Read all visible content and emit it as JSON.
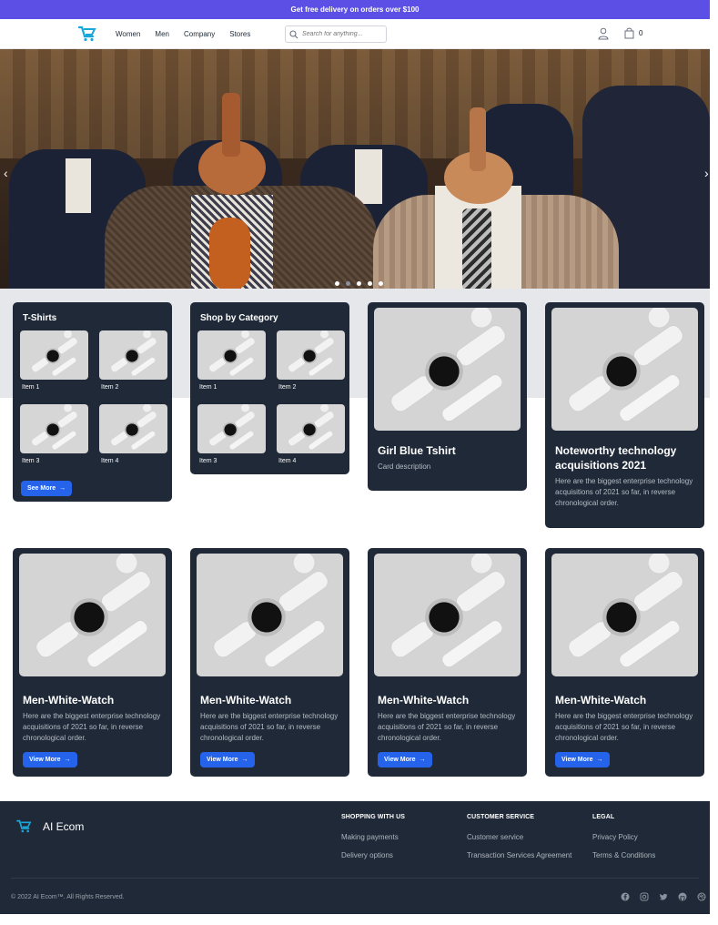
{
  "promo": {
    "text": "Get free delivery on orders over $100"
  },
  "header": {
    "nav": [
      "Women",
      "Men",
      "Company",
      "Stores"
    ],
    "search_placeholder": "Search for anything...",
    "cart_count": "0"
  },
  "hero": {
    "slides_total": 5,
    "active_slide": 1
  },
  "tshirts_card": {
    "title": "T-Shirts",
    "items": [
      "Item 1",
      "Item 2",
      "Item 3",
      "Item 4"
    ],
    "button": "See More"
  },
  "category_card": {
    "title": "Shop by Category",
    "items": [
      "Item 1",
      "Item 2",
      "Item 3",
      "Item 4"
    ]
  },
  "feature_cards": [
    {
      "title": "Girl Blue Tshirt",
      "desc": "Card description"
    },
    {
      "title": "Noteworthy technology acquisitions 2021",
      "desc": "Here are the biggest enterprise technology acquisitions of 2021 so far, in reverse chronological order."
    }
  ],
  "products": [
    {
      "title": "Men-White-Watch",
      "desc": "Here are the biggest enterprise technology acquisitions of 2021 so far, in reverse chronological order.",
      "button": "View More"
    },
    {
      "title": "Men-White-Watch",
      "desc": "Here are the biggest enterprise technology acquisitions of 2021 so far, in reverse chronological order.",
      "button": "View More"
    },
    {
      "title": "Men-White-Watch",
      "desc": "Here are the biggest enterprise technology acquisitions of 2021 so far, in reverse chronological order.",
      "button": "View More"
    },
    {
      "title": "Men-White-Watch",
      "desc": "Here are the biggest enterprise technology acquisitions of 2021 so far, in reverse chronological order.",
      "button": "View More"
    }
  ],
  "footer": {
    "brand": "AI Ecom",
    "columns": [
      {
        "heading": "SHOPPING WITH US",
        "links": [
          "Making payments",
          "Delivery options"
        ]
      },
      {
        "heading": "CUSTOMER SERVICE",
        "links": [
          "Customer service",
          "Transaction Services Agreement"
        ]
      },
      {
        "heading": "LEGAL",
        "links": [
          "Privacy Policy",
          "Terms & Conditions"
        ]
      }
    ],
    "copyright": "© 2022 AI Ecom™. All Rights Reserved.",
    "socials": [
      "facebook-icon",
      "instagram-icon",
      "twitter-icon",
      "github-icon",
      "dribbble-icon"
    ]
  },
  "colors": {
    "promo": "#5b4fe6",
    "card": "#1f2937",
    "button": "#2563eb",
    "logo": "#1aa6d9"
  }
}
